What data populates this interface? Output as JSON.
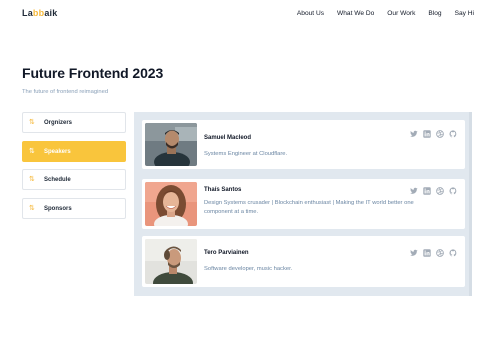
{
  "logo": {
    "part1": "La",
    "part2": "bb",
    "part3": "aik"
  },
  "nav": [
    "About Us",
    "What We Do",
    "Our Work",
    "Blog",
    "Say Hi"
  ],
  "page": {
    "title": "Future Frontend 2023",
    "subtitle": "The future of frontend reimagined"
  },
  "tabs": [
    {
      "label": "Orgnizers",
      "icon": "sort-arrows-icon",
      "active": false
    },
    {
      "label": "Speakers",
      "icon": "sort-arrows-icon",
      "active": true
    },
    {
      "label": "Schedule",
      "icon": "sort-arrows-icon",
      "active": false
    },
    {
      "label": "Sponsors",
      "icon": "sort-arrows-icon",
      "active": false
    }
  ],
  "speakers": [
    {
      "name": "Samuel Macleod",
      "bio": "Systems Engineer at Cloudflare."
    },
    {
      "name": "Thaís Santos",
      "bio": "Design Systems crusader | Blockchain enthusiast | Making the IT world better one component at a time."
    },
    {
      "name": "Tero Parviainen",
      "bio": "Software developer, music hacker."
    }
  ],
  "social_icons": [
    "twitter-icon",
    "linkedin-icon",
    "dribbble-icon",
    "github-icon"
  ],
  "colors": {
    "accent": "#f9c53c",
    "panel": "#e1e8ef",
    "muted_text": "#6b86a3"
  }
}
